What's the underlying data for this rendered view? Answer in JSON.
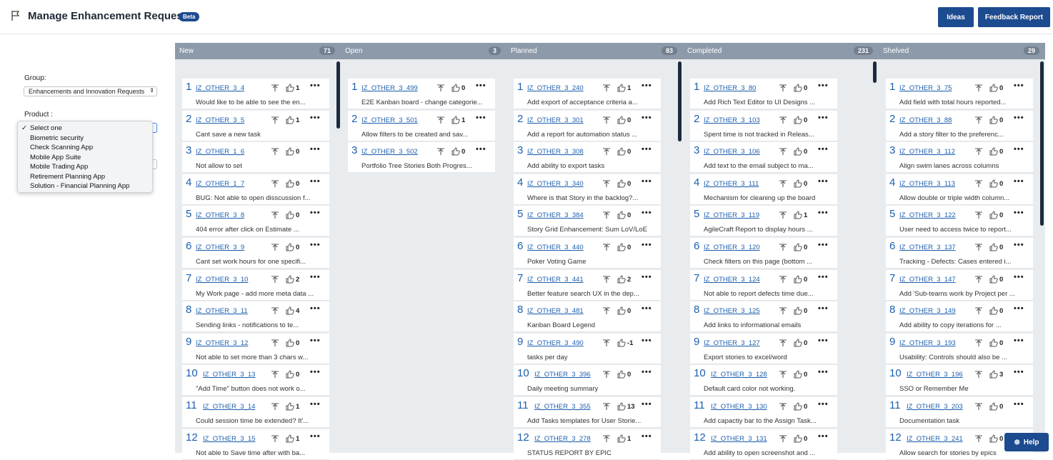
{
  "header": {
    "title": "Manage Enhancement Requests",
    "badge": "Beta",
    "ideas_label": "Ideas",
    "feedback_label": "Feedback Report"
  },
  "filters": {
    "group_label": "Group:",
    "group_value": "Enhancements and Innovation Requests",
    "product_label": "Product :",
    "product_options": [
      "Select one",
      "Biometric security",
      "Check Scanning App",
      "Mobile App Suite",
      "Mobile Trading App",
      "Retirement Planning App",
      "Solution - Financial Planning App"
    ],
    "product_selected": "Select one"
  },
  "help_label": "Help",
  "columns": [
    {
      "name": "New",
      "count": "71",
      "cards": [
        [
          "1",
          "IZ_OTHER_3_4",
          "1",
          "Would like to be able to see the en..."
        ],
        [
          "2",
          "IZ_OTHER_3_5",
          "1",
          "Cant save a new task"
        ],
        [
          "3",
          "IZ_OTHER_1_6",
          "0",
          "Not allow to set"
        ],
        [
          "4",
          "IZ_OTHER_1_7",
          "0",
          "BUG: Not able to open disscussion f..."
        ],
        [
          "5",
          "IZ_OTHER_3_8",
          "0",
          "404 error after click on Estimate ..."
        ],
        [
          "6",
          "IZ_OTHER_3_9",
          "0",
          "Cant set work hours for one specifi..."
        ],
        [
          "7",
          "IZ_OTHER_3_10",
          "2",
          "My Work page - add more meta data ..."
        ],
        [
          "8",
          "IZ_OTHER_3_11",
          "4",
          "Sending links - notifications to te..."
        ],
        [
          "9",
          "IZ_OTHER_3_12",
          "0",
          "Not able to set more than 3 chars w..."
        ],
        [
          "10",
          "IZ_OTHER_3_13",
          "0",
          "\"Add Time\" button does not work o..."
        ],
        [
          "11",
          "IZ_OTHER_3_14",
          "1",
          "Could session time be extended? It'..."
        ],
        [
          "12",
          "IZ_OTHER_3_15",
          "1",
          "Not able to Save time after with ba..."
        ]
      ]
    },
    {
      "name": "Open",
      "count": "3",
      "cards": [
        [
          "1",
          "IZ_OTHER_3_499",
          "0",
          "E2E Kanban board - change categorie..."
        ],
        [
          "2",
          "IZ_OTHER_3_501",
          "1",
          "Allow filters to be created and sav..."
        ],
        [
          "3",
          "IZ_OTHER_3_502",
          "0",
          "Portfolio Tree Stories Both Progres..."
        ]
      ]
    },
    {
      "name": "Planned",
      "count": "83",
      "cards": [
        [
          "1",
          "IZ_OTHER_3_240",
          "1",
          "Add export of acceptance criteria a..."
        ],
        [
          "2",
          "IZ_OTHER_3_301",
          "0",
          "Add a report for automation status ..."
        ],
        [
          "3",
          "IZ_OTHER_3_308",
          "0",
          "Add ability to export tasks"
        ],
        [
          "4",
          "IZ_OTHER_3_340",
          "0",
          "Where is that Story in the backlog?..."
        ],
        [
          "5",
          "IZ_OTHER_3_384",
          "0",
          "Story Grid Enhancement: Sum LoV/LoE"
        ],
        [
          "6",
          "IZ_OTHER_3_440",
          "0",
          "Poker Voting Game"
        ],
        [
          "7",
          "IZ_OTHER_3_441",
          "2",
          "Better feature search UX in the dep..."
        ],
        [
          "8",
          "IZ_OTHER_3_481",
          "0",
          "Kanban Board Legend"
        ],
        [
          "9",
          "IZ_OTHER_3_490",
          "-1",
          "tasks per day"
        ],
        [
          "10",
          "IZ_OTHER_3_396",
          "0",
          "Daily meeting summary"
        ],
        [
          "11",
          "IZ_OTHER_3_355",
          "13",
          "Add Tasks templates for User Storie..."
        ],
        [
          "12",
          "IZ_OTHER_3_278",
          "1",
          "STATUS REPORT BY EPIC"
        ]
      ]
    },
    {
      "name": "Completed",
      "count": "231",
      "cards": [
        [
          "1",
          "IZ_OTHER_3_80",
          "0",
          "Add Rich Text Editor to UI Designs ..."
        ],
        [
          "2",
          "IZ_OTHER_3_103",
          "0",
          "Spent time is not tracked in Releas..."
        ],
        [
          "3",
          "IZ_OTHER_3_106",
          "0",
          "Add text to the email subject to ma..."
        ],
        [
          "4",
          "IZ_OTHER_3_111",
          "0",
          "Mechanism for cleaning up the board"
        ],
        [
          "5",
          "IZ_OTHER_3_119",
          "1",
          "AgileCraft Report to display hours ..."
        ],
        [
          "6",
          "IZ_OTHER_3_120",
          "0",
          "Check filters on this page (bottom ..."
        ],
        [
          "7",
          "IZ_OTHER_3_124",
          "0",
          "Not able to report defects time due..."
        ],
        [
          "8",
          "IZ_OTHER_3_125",
          "0",
          "Add links to informational emails"
        ],
        [
          "9",
          "IZ_OTHER_3_127",
          "0",
          "Export stories to excel/word"
        ],
        [
          "10",
          "IZ_OTHER_3_128",
          "0",
          "Default card color not working."
        ],
        [
          "11",
          "IZ_OTHER_3_130",
          "0",
          "Add capactiy bar to the Assign Task..."
        ],
        [
          "12",
          "IZ_OTHER_3_131",
          "0",
          "Add ability to open screenshot and ..."
        ]
      ]
    },
    {
      "name": "Shelved",
      "count": "29",
      "cards": [
        [
          "1",
          "IZ_OTHER_3_75",
          "0",
          "Add field with total hours reported..."
        ],
        [
          "2",
          "IZ_OTHER_3_88",
          "0",
          "Add a story filter to the preferenc..."
        ],
        [
          "3",
          "IZ_OTHER_3_112",
          "0",
          "Align swim lanes across columns"
        ],
        [
          "4",
          "IZ_OTHER_3_113",
          "0",
          "Allow double or triple width column..."
        ],
        [
          "5",
          "IZ_OTHER_3_122",
          "0",
          "User need to access twice to report..."
        ],
        [
          "6",
          "IZ_OTHER_3_137",
          "0",
          "Tracking - Defects: Cases entered i..."
        ],
        [
          "7",
          "IZ_OTHER_3_147",
          "0",
          "Add 'Sub-teams work by Project per ..."
        ],
        [
          "8",
          "IZ_OTHER_3_149",
          "0",
          "Add ability to copy iterations for ..."
        ],
        [
          "9",
          "IZ_OTHER_3_193",
          "0",
          "Usability: Controls should also be ..."
        ],
        [
          "10",
          "IZ_OTHER_3_196",
          "3",
          "SSO or Remember Me"
        ],
        [
          "11",
          "IZ_OTHER_3_203",
          "0",
          "Documentation task"
        ],
        [
          "12",
          "IZ_OTHER_3_241",
          "0",
          "Allow search for stories by epics"
        ]
      ]
    }
  ]
}
